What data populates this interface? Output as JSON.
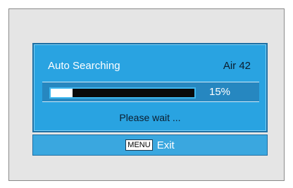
{
  "search_dialog": {
    "title": "Auto Searching",
    "channel": "Air 42",
    "progress_fraction": 0.15,
    "progress_label": "15%",
    "status": "Please wait ..."
  },
  "footer": {
    "key_label": "MENU",
    "action_label": "Exit"
  },
  "colors": {
    "panel_blue": "#29a3e1",
    "progress_row_blue": "#2687c0",
    "footer_blue": "#3aa7df",
    "screen_gray": "#e5e5e5"
  }
}
